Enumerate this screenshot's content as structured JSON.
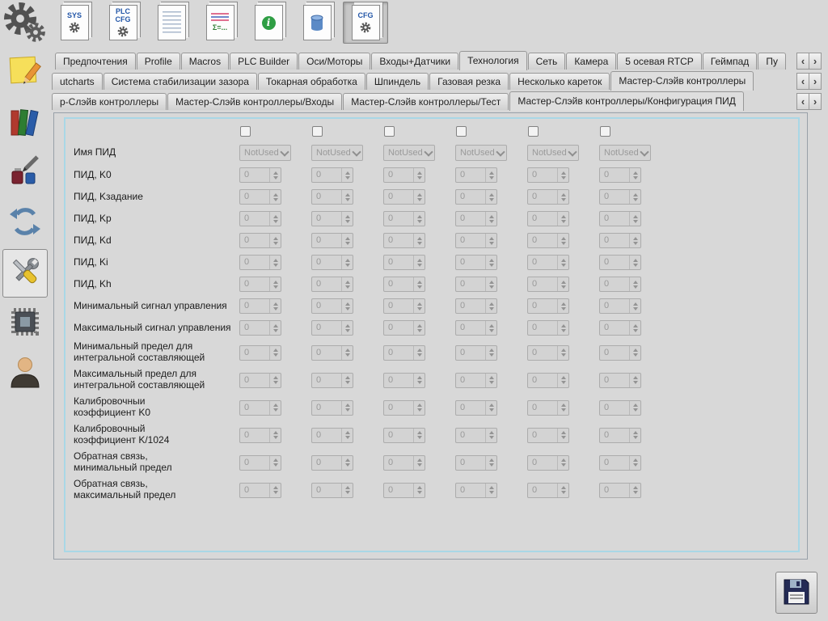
{
  "window": {
    "background": "#d8d8d8",
    "panel_border": "#a9d7e6"
  },
  "toolbar": {
    "buttons": [
      {
        "id": "sys",
        "text": "SYS",
        "text_color": "#2457a8",
        "icon": "gear",
        "selected": false
      },
      {
        "id": "plc-cfg",
        "text": "PLC\nCFG",
        "text_color": "#2457a8",
        "icon": "gear",
        "selected": false
      },
      {
        "id": "documents",
        "text": "",
        "text_color": "",
        "icon": "pages",
        "selected": false
      },
      {
        "id": "summary",
        "text": "Σ=...",
        "text_color": "#2e7d32",
        "icon": "lines",
        "selected": false
      },
      {
        "id": "info",
        "text": "",
        "text_color": "",
        "icon": "info",
        "selected": false
      },
      {
        "id": "database",
        "text": "",
        "text_color": "",
        "icon": "database",
        "selected": false
      },
      {
        "id": "cfg",
        "text": "CFG",
        "text_color": "#2457a8",
        "icon": "gear",
        "selected": true
      }
    ]
  },
  "sidebar": {
    "items": [
      {
        "id": "notes",
        "icon": "sticky-note-pencil-icon",
        "selected": false
      },
      {
        "id": "manuals",
        "icon": "books-icon",
        "selected": false
      },
      {
        "id": "supplies",
        "icon": "ink-tools-icon",
        "selected": false
      },
      {
        "id": "sync",
        "icon": "circular-arrows-icon",
        "selected": false
      },
      {
        "id": "configuration",
        "icon": "wrench-tools-icon",
        "selected": true
      },
      {
        "id": "hardware",
        "icon": "chip-icon",
        "selected": false
      },
      {
        "id": "operator",
        "icon": "user-icon",
        "selected": false
      }
    ]
  },
  "tab_scroll": {
    "left_icon": "‹",
    "right_icon": "›"
  },
  "tab_rows": [
    {
      "id": "main",
      "tabs": [
        "Предпочтения",
        "Profile",
        "Macros",
        "PLC Builder",
        "Оси/Моторы",
        "Входы+Датчики",
        "Технология",
        "Сеть",
        "Камера",
        "5 осевая RTCP",
        "Геймпад",
        "Пу"
      ],
      "selected_index": 6
    },
    {
      "id": "technology",
      "tabs": [
        "utcharts",
        "Система стабилизации зазора",
        "Токарная обработка",
        "Шпиндель",
        "Газовая резка",
        "Несколько кареток",
        "Мастер-Слэйв контроллеры"
      ],
      "selected_index": 6
    },
    {
      "id": "master-slave",
      "tabs": [
        "р-Слэйв контроллеры",
        "Мастер-Слэйв контроллеры/Входы",
        "Мастер-Слэйв контроллеры/Тест",
        "Мастер-Слэйв контроллеры/Конфигурация ПИД"
      ],
      "selected_index": 3
    }
  ],
  "pid_form": {
    "column_checkboxes": [
      false,
      false,
      false,
      false,
      false,
      false
    ],
    "rows": [
      {
        "id": "pid-name",
        "label": "Имя ПИД",
        "control": "select",
        "enabled": false,
        "values": [
          "NotUsed",
          "NotUsed",
          "NotUsed",
          "NotUsed",
          "NotUsed",
          "NotUsed"
        ]
      },
      {
        "id": "pid-k0",
        "label": "ПИД, K0",
        "control": "spin",
        "enabled": false,
        "values": [
          "0",
          "0",
          "0",
          "0",
          "0",
          "0"
        ]
      },
      {
        "id": "pid-ksetpoint",
        "label": "ПИД, Kзадание",
        "control": "spin",
        "enabled": false,
        "values": [
          "0",
          "0",
          "0",
          "0",
          "0",
          "0"
        ]
      },
      {
        "id": "pid-kp",
        "label": "ПИД, Kp",
        "control": "spin",
        "enabled": false,
        "values": [
          "0",
          "0",
          "0",
          "0",
          "0",
          "0"
        ]
      },
      {
        "id": "pid-kd",
        "label": "ПИД, Kd",
        "control": "spin",
        "enabled": false,
        "values": [
          "0",
          "0",
          "0",
          "0",
          "0",
          "0"
        ]
      },
      {
        "id": "pid-ki",
        "label": "ПИД, Ki",
        "control": "spin",
        "enabled": false,
        "values": [
          "0",
          "0",
          "0",
          "0",
          "0",
          "0"
        ]
      },
      {
        "id": "pid-kh",
        "label": "ПИД, Kh",
        "control": "spin",
        "enabled": false,
        "values": [
          "0",
          "0",
          "0",
          "0",
          "0",
          "0"
        ]
      },
      {
        "id": "min-control-signal",
        "label": "Минимальный сигнал управления",
        "control": "spin",
        "enabled": false,
        "values": [
          "0",
          "0",
          "0",
          "0",
          "0",
          "0"
        ]
      },
      {
        "id": "max-control-signal",
        "label": "Максимальный сигнал управления",
        "control": "spin",
        "enabled": false,
        "values": [
          "0",
          "0",
          "0",
          "0",
          "0",
          "0"
        ]
      },
      {
        "id": "min-integral-limit",
        "label": "Минимальный предел для\nинтегральной составляющей",
        "control": "spin",
        "enabled": false,
        "values": [
          "0",
          "0",
          "0",
          "0",
          "0",
          "0"
        ]
      },
      {
        "id": "max-integral-limit",
        "label": "Максимальный предел для\nинтегральной составляющей",
        "control": "spin",
        "enabled": false,
        "values": [
          "0",
          "0",
          "0",
          "0",
          "0",
          "0"
        ]
      },
      {
        "id": "calib-k0",
        "label": "Калибровочныи\nкоэффициент K0",
        "control": "spin",
        "enabled": false,
        "values": [
          "0",
          "0",
          "0",
          "0",
          "0",
          "0"
        ]
      },
      {
        "id": "calib-k1024",
        "label": "Калибровочный\nкоэффициент K/1024",
        "control": "spin",
        "enabled": false,
        "values": [
          "0",
          "0",
          "0",
          "0",
          "0",
          "0"
        ]
      },
      {
        "id": "feedback-min",
        "label": "Обратная связь,\nминимальный предел",
        "control": "spin",
        "enabled": false,
        "values": [
          "0",
          "0",
          "0",
          "0",
          "0",
          "0"
        ]
      },
      {
        "id": "feedback-max",
        "label": "Обратная связь,\nмаксимальный предел",
        "control": "spin",
        "enabled": false,
        "values": [
          "0",
          "0",
          "0",
          "0",
          "0",
          "0"
        ]
      }
    ]
  },
  "save_button": {
    "icon": "floppy-disk-icon"
  }
}
